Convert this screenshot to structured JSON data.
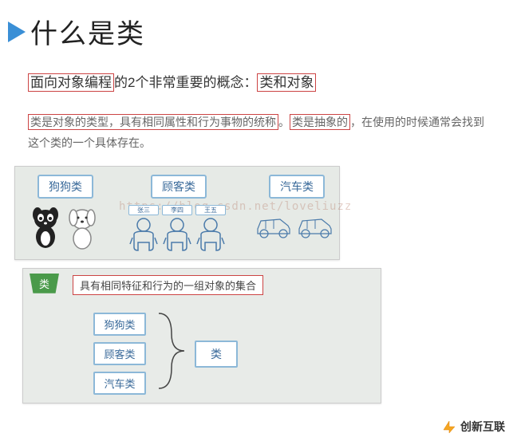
{
  "header": {
    "title": "什么是类"
  },
  "paragraph1": {
    "part1": "面向对象编程",
    "part2": "的2个非常重要的概念：",
    "part3": "类和对象"
  },
  "paragraph2": {
    "part1": "类是对象的类型，具有相同属性和行为事物的统称",
    "part2": "。",
    "part3": "类是抽象的",
    "part4": "，在使用的时候通常会找到这个类的一个具体存在。"
  },
  "diagram1": {
    "label_dog": "狗狗类",
    "label_customer": "顾客类",
    "label_car": "汽车类",
    "people": [
      "张三",
      "李四",
      "王五"
    ],
    "watermark": "https://blog.csdn.net/loveliuzz"
  },
  "diagram2": {
    "tag": "类",
    "definition": "具有相同特征和行为的一组对象的集合",
    "items": [
      "狗狗类",
      "顾客类",
      "汽车类"
    ],
    "result": "类"
  },
  "logo": {
    "text": "创新互联"
  }
}
